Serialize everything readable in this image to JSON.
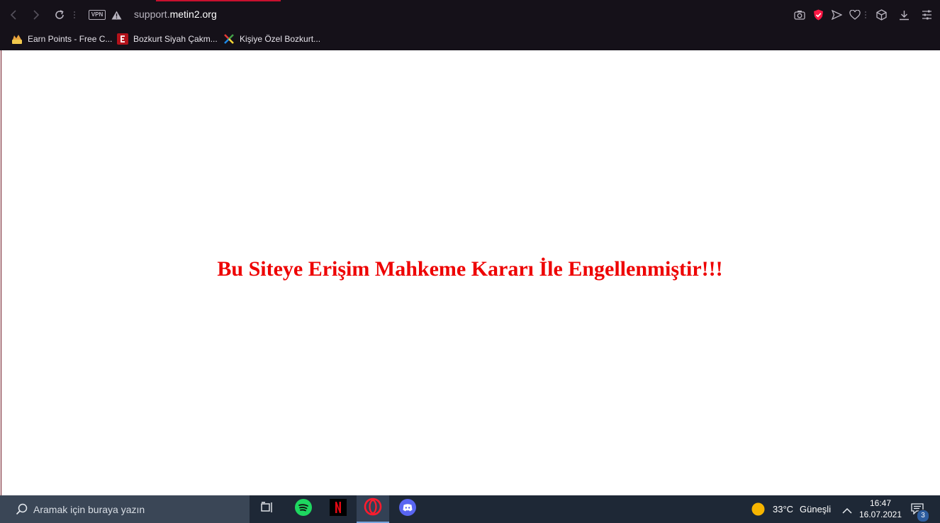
{
  "browser": {
    "url_prefix": "support.",
    "url_host": "metin2.org",
    "vpn_label": "VPN",
    "accent_color": "#c8102e"
  },
  "bookmarks": [
    {
      "label": "Earn Points - Free C...",
      "icon": "crown-icon"
    },
    {
      "label": "Bozkurt Siyah Çakm...",
      "icon": "red-logo-icon"
    },
    {
      "label": "Kişiye Özel Bozkurt...",
      "icon": "multicolor-star-icon"
    }
  ],
  "page": {
    "notice": "Bu Siteye Erişim Mahkeme Kararı İle Engellenmiştir!!!",
    "notice_color": "#ee0000"
  },
  "taskbar": {
    "search_placeholder": "Aramak için buraya yazın",
    "apps": [
      "task-view",
      "spotify",
      "netflix",
      "opera",
      "discord"
    ],
    "weather_temp": "33°C",
    "weather_desc": "Güneşli",
    "time": "16:47",
    "date": "16.07.2021",
    "notification_count": "3"
  }
}
